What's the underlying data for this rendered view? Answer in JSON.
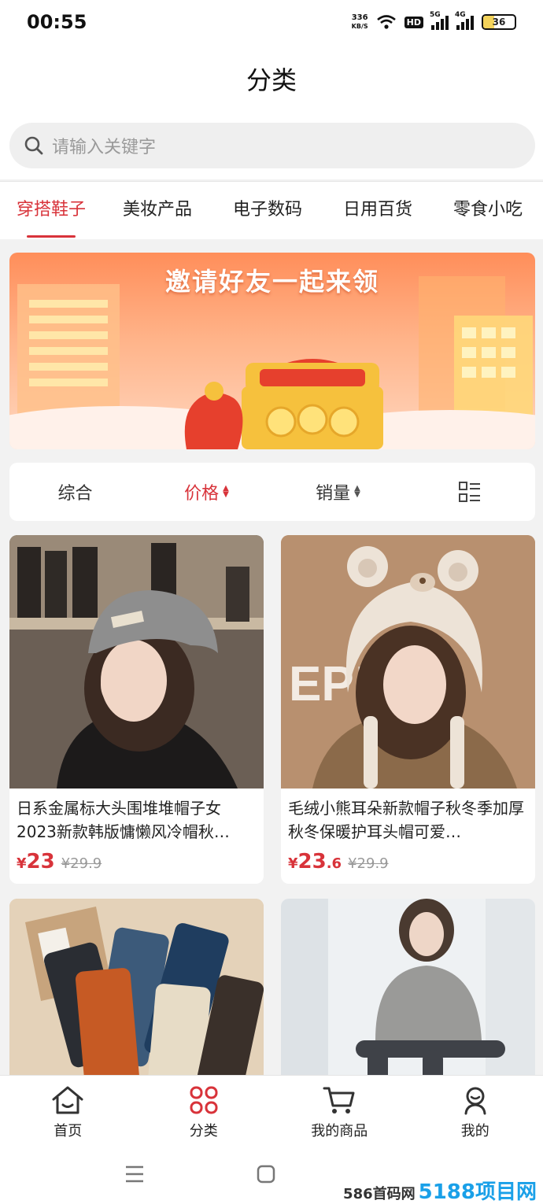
{
  "status_bar": {
    "time": "00:55",
    "speed_value": "336",
    "speed_unit": "KB/S",
    "hd": "HD",
    "signal1": "5G",
    "signal2": "4G",
    "battery": "36"
  },
  "header": {
    "title": "分类"
  },
  "search": {
    "placeholder": "请输入关键字"
  },
  "category_tabs": [
    "穿搭鞋子",
    "美妆产品",
    "电子数码",
    "日用百货",
    "零食小吃"
  ],
  "banner": {
    "caption": "邀请好友一起来领"
  },
  "sort": {
    "comprehensive": "综合",
    "price": "价格",
    "sales": "销量"
  },
  "products": [
    {
      "name": "日系金属标大头围堆堆帽子女2023新款韩版慵懒风冷帽秋…",
      "price_symbol": "¥",
      "price_int": "23",
      "price_dec": "",
      "old_price": "¥29.9"
    },
    {
      "name": "毛绒小熊耳朵新款帽子秋冬季加厚秋冬保暖护耳头帽可爱…",
      "price_symbol": "¥",
      "price_int": "23",
      "price_dec": ".6",
      "old_price": "¥29.9"
    }
  ],
  "bottom_nav": {
    "home": "首页",
    "category": "分类",
    "my_goods": "我的商品",
    "mine": "我的"
  },
  "watermark": {
    "text": "586首码网",
    "brand": "5188项目网"
  },
  "colors": {
    "accent": "#d8333a",
    "page_bg": "#f2f2f2"
  },
  "icons": [
    "search-icon",
    "sort-arrows-icon",
    "list-view-icon",
    "home-icon",
    "category-grid-icon",
    "cart-icon",
    "person-icon",
    "menu-icon",
    "square-icon",
    "back-icon",
    "wifi-icon",
    "signal-icon",
    "battery-icon"
  ]
}
